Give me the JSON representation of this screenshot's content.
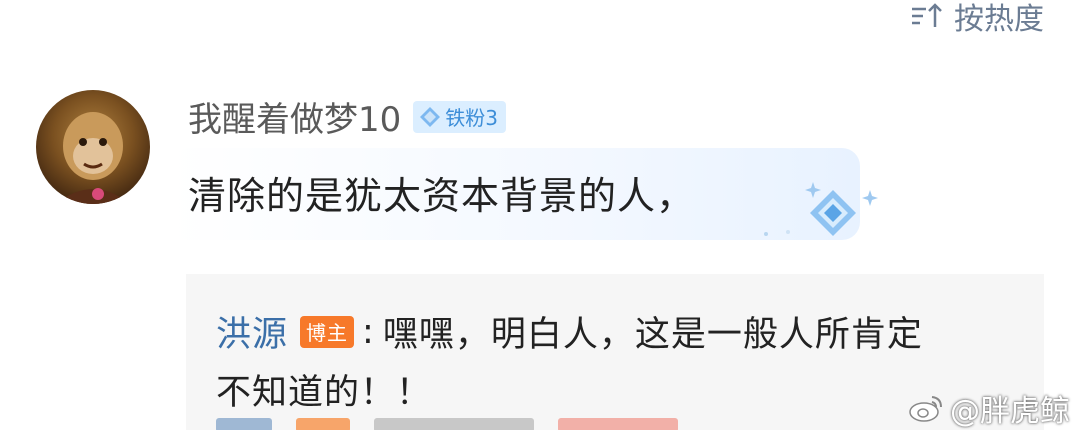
{
  "sort": {
    "label": "按热度",
    "icon": "sort-icon"
  },
  "comment": {
    "username": "我醒着做梦10",
    "fan_badge": "铁粉3",
    "text": "清除的是犹太资本背景的人，",
    "avatar_icon": "avatar-image"
  },
  "reply": {
    "author": "洪源",
    "badge": "博主",
    "separator": ":",
    "text_line1": "嘿嘿，明白人，这是一般人所肯定",
    "text_line2": "不知道的！！"
  },
  "watermark": {
    "text": "@胖虎鲸",
    "icon": "weibo-logo-icon"
  },
  "colors": {
    "link_blue": "#3b6fa8",
    "blogger_orange": "#f7792a",
    "fan_badge_bg": "#dbeeff",
    "fan_badge_fg": "#3d8ed8"
  }
}
